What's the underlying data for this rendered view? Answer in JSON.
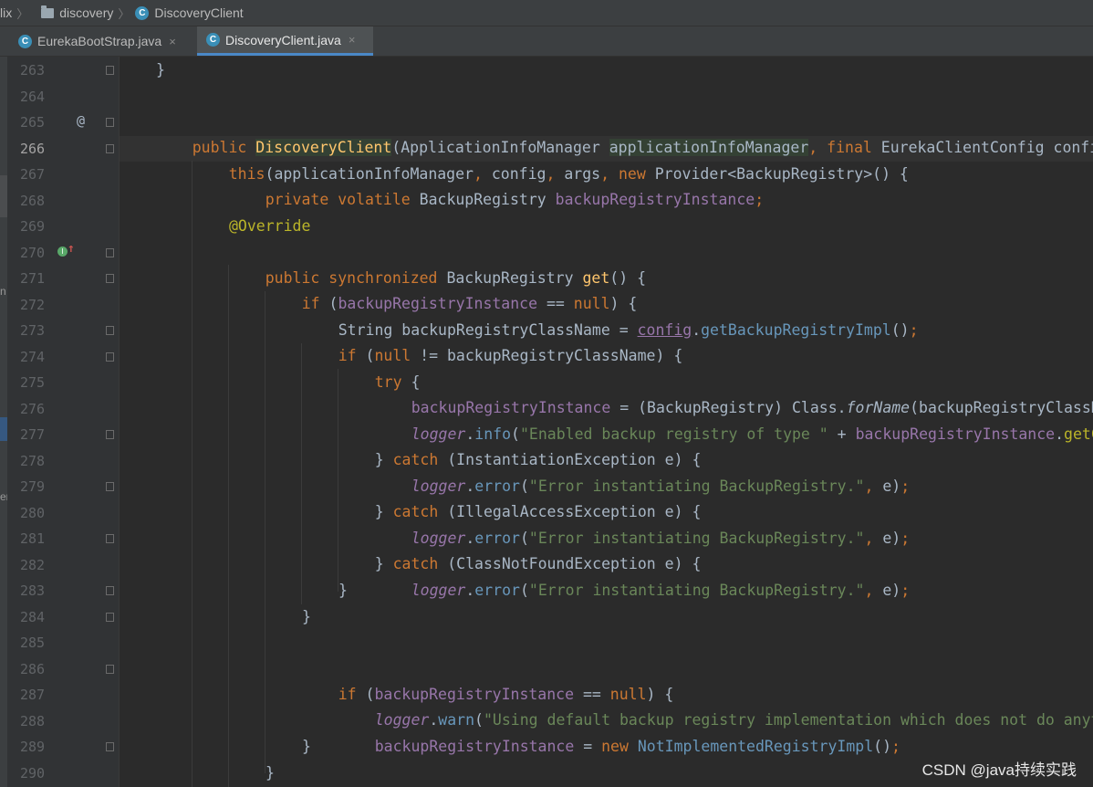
{
  "breadcrumb": {
    "items": [
      {
        "label": "lix",
        "icon": "none"
      },
      {
        "label": "discovery",
        "icon": "folder-icon"
      },
      {
        "label": "DiscoveryClient",
        "icon": "class-icon"
      }
    ]
  },
  "tabs": [
    {
      "label": "EurekaBootStrap.java",
      "close": "×",
      "active": false
    },
    {
      "label": "DiscoveryClient.java",
      "close": "×",
      "active": true
    }
  ],
  "side_labels": [
    "n",
    "er"
  ],
  "gutter": {
    "current_line": "266",
    "line_numbers": [
      "263",
      "264",
      "265",
      "266",
      "267",
      "268",
      "269",
      "270",
      "271",
      "272",
      "273",
      "274",
      "275",
      "276",
      "277",
      "278",
      "279",
      "280",
      "281",
      "282",
      "283",
      "284",
      "285",
      "286",
      "287",
      "288",
      "289",
      "290"
    ],
    "at_marker": "@",
    "override_badge": "I"
  },
  "code": {
    "l263": "}",
    "l265": {
      "kw1": "public",
      "ctor": "DiscoveryClient",
      "p1": "(ApplicationInfoManager ",
      "param": "applicationInfoManager",
      "comma": ",",
      "kw2": "final",
      "rest": "EurekaClientConfig config,"
    },
    "l266": {
      "kw": "this",
      "open": "(",
      "p1": "applicationInfoManager",
      "c1": ",",
      "p2": "config",
      "c2": ",",
      "p3": "args",
      "c3": ",",
      "kw2": "new",
      "rest": "Provider<BackupRegistry>() {"
    },
    "l267": {
      "kw": "private volatile",
      "type": "BackupRegistry",
      "field": "backupRegistryInstance",
      "semi": ";"
    },
    "l269": "@Override",
    "l270": {
      "kw": "public synchronized",
      "type": "BackupRegistry",
      "method": "get",
      "rest": "() {"
    },
    "l271": {
      "kw": "if",
      "open": " (",
      "field": "backupRegistryInstance",
      "op": " == ",
      "kw2": "null",
      "rest": ") {"
    },
    "l272": {
      "type": "String backupRegistryClassName = ",
      "field": "config",
      "dot": ".",
      "method": "getBackupRegistryImpl",
      "rest": "()",
      "semi": ";"
    },
    "l273": {
      "kw": "if",
      "open": " (",
      "kw2": "null",
      "rest": " != backupRegistryClassName) {"
    },
    "l274": {
      "kw": "try",
      "rest": " {"
    },
    "l275": {
      "field": "backupRegistryInstance",
      "rest1": " = (BackupRegistry) Class.",
      "method": "forName",
      "rest2": "(backupRegistryClassName"
    },
    "l276": {
      "logger": "logger",
      "dot": ".",
      "method": "info",
      "open": "(",
      "str": "\"Enabled backup registry of type \"",
      "plus": " + ",
      "field": "backupRegistryInstance",
      "dot2": ".",
      "tail": "getClas"
    },
    "l277": {
      "brace": "} ",
      "kw": "catch",
      "rest": " (InstantiationException e) {"
    },
    "l278": {
      "logger": "logger",
      "dot": ".",
      "method": "error",
      "open": "(",
      "str": "\"Error instantiating BackupRegistry.\"",
      "comma": ",",
      "rest": " e)",
      "semi": ";"
    },
    "l279": {
      "brace": "} ",
      "kw": "catch",
      "rest": " (IllegalAccessException e) {"
    },
    "l280": {
      "logger": "logger",
      "dot": ".",
      "method": "error",
      "open": "(",
      "str": "\"Error instantiating BackupRegistry.\"",
      "comma": ",",
      "rest": " e)",
      "semi": ";"
    },
    "l281": {
      "brace": "} ",
      "kw": "catch",
      "rest": " (ClassNotFoundException e) {"
    },
    "l282": {
      "logger": "logger",
      "dot": ".",
      "method": "error",
      "open": "(",
      "str": "\"Error instantiating BackupRegistry.\"",
      "comma": ",",
      "rest": " e)",
      "semi": ";"
    },
    "l283": "}",
    "l284": "}",
    "l286": {
      "kw": "if",
      "open": " (",
      "field": "backupRegistryInstance",
      "op": " == ",
      "kw2": "null",
      "rest": ") {"
    },
    "l287": {
      "logger": "logger",
      "dot": ".",
      "method": "warn",
      "open": "(",
      "str": "\"Using default backup registry implementation which does not do anythin"
    },
    "l288": {
      "field": "backupRegistryInstance",
      "op": " = ",
      "kw": "new",
      "cls": " NotImplementedRegistryImpl",
      "rest": "()",
      "semi": ";"
    },
    "l289": "}",
    "l290": "}"
  },
  "watermark": "CSDN @java持续实践",
  "colors": {
    "background": "#2b2b2b",
    "keyword": "#cc7832",
    "string": "#6a8759",
    "field": "#9876aa",
    "method": "#ffc66d",
    "annotation": "#bbb529",
    "text": "#a9b7c6"
  }
}
